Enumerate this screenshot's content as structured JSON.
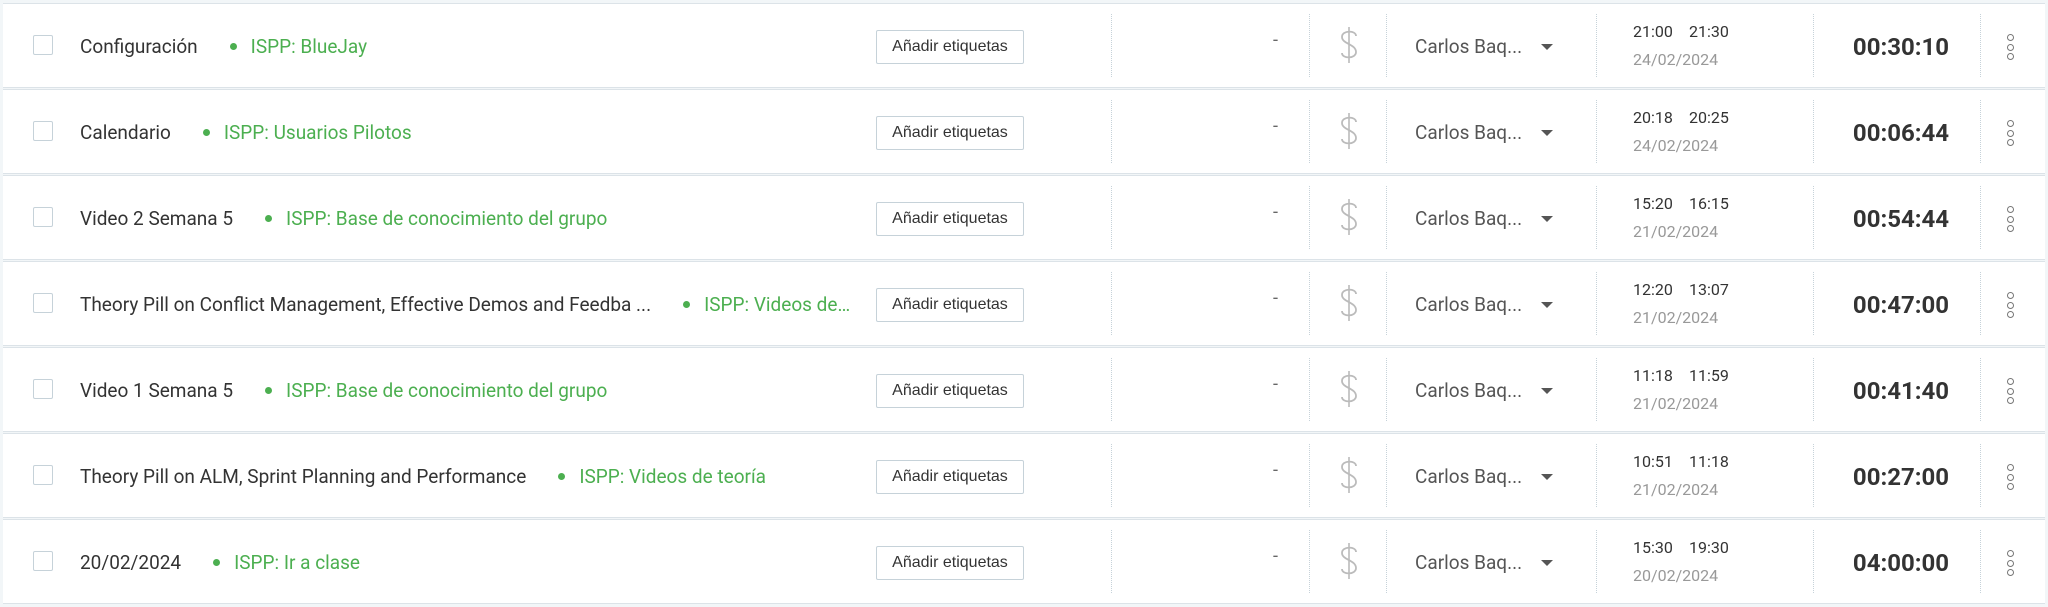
{
  "colors": {
    "project_green": "#4caf50"
  },
  "entries": [
    {
      "description": "Configuración",
      "project": "ISPP: BlueJay",
      "tag_button": "Añadir etiquetas",
      "tags_value": "-",
      "billable_icon": "dollar-icon",
      "user": "Carlos Baq...",
      "start": "21:00",
      "end": "21:30",
      "date": "24/02/2024",
      "duration": "00:30:10"
    },
    {
      "description": "Calendario",
      "project": "ISPP: Usuarios Pilotos",
      "tag_button": "Añadir etiquetas",
      "tags_value": "-",
      "billable_icon": "dollar-icon",
      "user": "Carlos Baq...",
      "start": "20:18",
      "end": "20:25",
      "date": "24/02/2024",
      "duration": "00:06:44"
    },
    {
      "description": "Video 2 Semana 5",
      "project": "ISPP: Base de conocimiento del grupo",
      "tag_button": "Añadir etiquetas",
      "tags_value": "-",
      "billable_icon": "dollar-icon",
      "user": "Carlos Baq...",
      "start": "15:20",
      "end": "16:15",
      "date": "21/02/2024",
      "duration": "00:54:44"
    },
    {
      "description": "Theory Pill on Conflict Management, Effective Demos and Feedba ...",
      "project": "ISPP: Videos de ...",
      "tag_button": "Añadir etiquetas",
      "tags_value": "-",
      "billable_icon": "dollar-icon",
      "user": "Carlos Baq...",
      "start": "12:20",
      "end": "13:07",
      "date": "21/02/2024",
      "duration": "00:47:00"
    },
    {
      "description": "Video 1 Semana 5",
      "project": "ISPP: Base de conocimiento del grupo",
      "tag_button": "Añadir etiquetas",
      "tags_value": "-",
      "billable_icon": "dollar-icon",
      "user": "Carlos Baq...",
      "start": "11:18",
      "end": "11:59",
      "date": "21/02/2024",
      "duration": "00:41:40"
    },
    {
      "description": "Theory Pill on ALM, Sprint Planning and Performance",
      "project": "ISPP: Videos de teoría",
      "tag_button": "Añadir etiquetas",
      "tags_value": "-",
      "billable_icon": "dollar-icon",
      "user": "Carlos Baq...",
      "start": "10:51",
      "end": "11:18",
      "date": "21/02/2024",
      "duration": "00:27:00"
    },
    {
      "description": "20/02/2024",
      "project": "ISPP: Ir a clase",
      "tag_button": "Añadir etiquetas",
      "tags_value": "-",
      "billable_icon": "dollar-icon",
      "user": "Carlos Baq...",
      "start": "15:30",
      "end": "19:30",
      "date": "20/02/2024",
      "duration": "04:00:00"
    }
  ]
}
